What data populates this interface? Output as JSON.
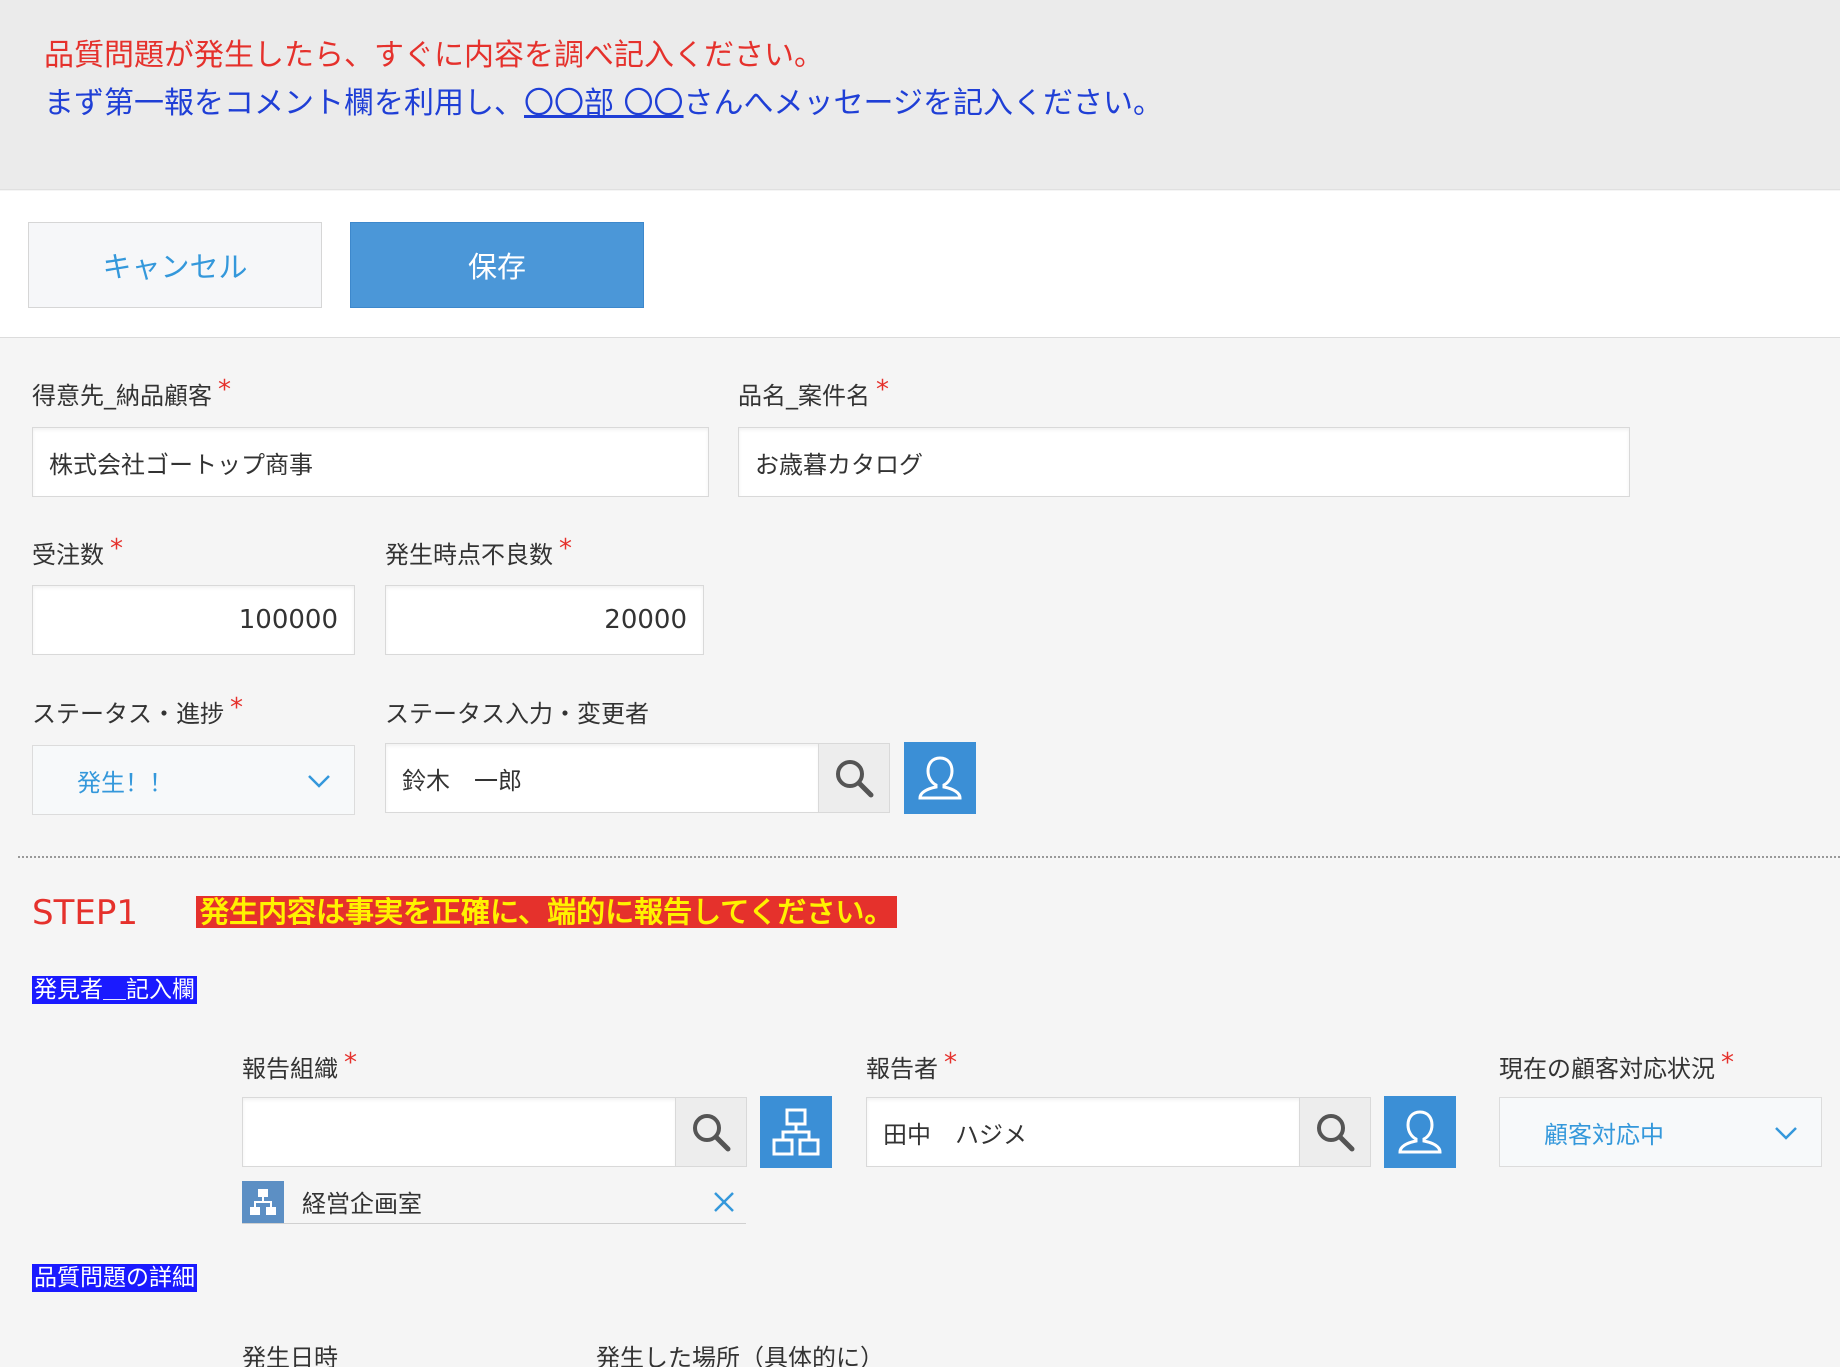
{
  "notice": {
    "line1": "品質問題が発生したら、すぐに内容を調べ記入ください。",
    "line2_prefix": "まず第一報をコメント欄を利用し、",
    "line2_link": "〇〇部 〇〇",
    "line2_suffix": "さんへメッセージを記入ください。"
  },
  "toolbar": {
    "cancel_label": "キャンセル",
    "save_label": "保存"
  },
  "fields": {
    "customer": {
      "label": "得意先_納品顧客",
      "value": "株式会社ゴートップ商事"
    },
    "product": {
      "label": "品名_案件名",
      "value": "お歳暮カタログ"
    },
    "order_qty": {
      "label": "受注数",
      "value": "100000"
    },
    "defect_qty": {
      "label": "発生時点不良数",
      "value": "20000"
    },
    "status": {
      "label": "ステータス・進捗",
      "value": "発生！！"
    },
    "status_changer": {
      "label": "ステータス入力・変更者",
      "value": "鈴木　一郎"
    },
    "required_mark": "*"
  },
  "step1": {
    "title": "STEP1",
    "message": "発生内容は事実を正確に、端的に報告してください。"
  },
  "finder_section": {
    "tag": "発見者＿記入欄",
    "report_org": {
      "label": "報告組織",
      "value": "",
      "chip": "経営企画室"
    },
    "reporter": {
      "label": "報告者",
      "value": "田中　ハジメ"
    },
    "customer_status": {
      "label": "現在の顧客対応状況",
      "value": "顧客対応中"
    }
  },
  "detail_section": {
    "tag": "品質問題の詳細",
    "occurred_at_label": "発生日時",
    "place_label": "発生した場所（具体的に）"
  },
  "colors": {
    "alert_red": "#e5312c",
    "link_blue": "#1f3fd6",
    "accent_blue": "#4b97d8",
    "highlight_yellow": "#fff200",
    "tag_blue": "#1a1aff"
  }
}
